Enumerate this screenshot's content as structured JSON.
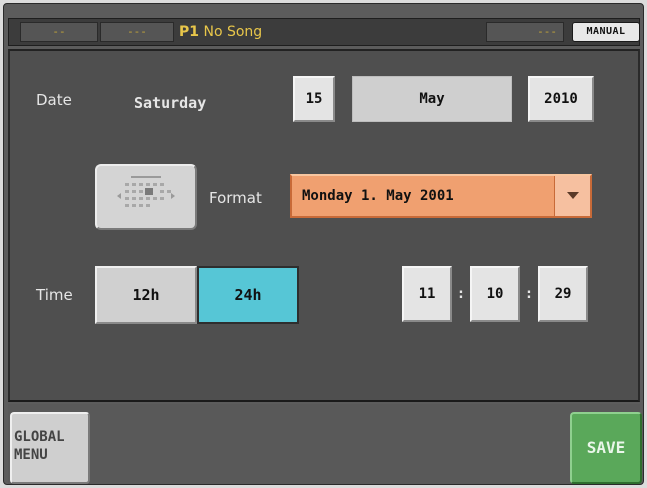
{
  "status_bar": {
    "slot_a": "--",
    "slot_b": "---",
    "song_prefix": "P1",
    "song_name": "No Song",
    "slot_c": "---",
    "mode_label": "MANUAL"
  },
  "date": {
    "label": "Date",
    "weekday": "Saturday",
    "day": "15",
    "month": "May",
    "year": "2010"
  },
  "format": {
    "label": "Format",
    "selected": "Monday 1. May 2001",
    "calendar_icon": "calendar-icon",
    "dropdown_icon": "chevron-down-icon"
  },
  "time": {
    "label": "Time",
    "option_12h": "12h",
    "option_24h": "24h",
    "selected_mode": "24h",
    "hours": "11",
    "minutes": "10",
    "seconds": "29",
    "separator": ":"
  },
  "bottom": {
    "global_line1": "GLOBAL",
    "global_line2": "MENU",
    "save_label": "SAVE"
  },
  "colors": {
    "background": "#5c5c5c",
    "selected_toggle": "#56c6d6",
    "dropdown": "#f0a070",
    "save_button": "#5aa85a",
    "status_text": "#e8c64a"
  }
}
